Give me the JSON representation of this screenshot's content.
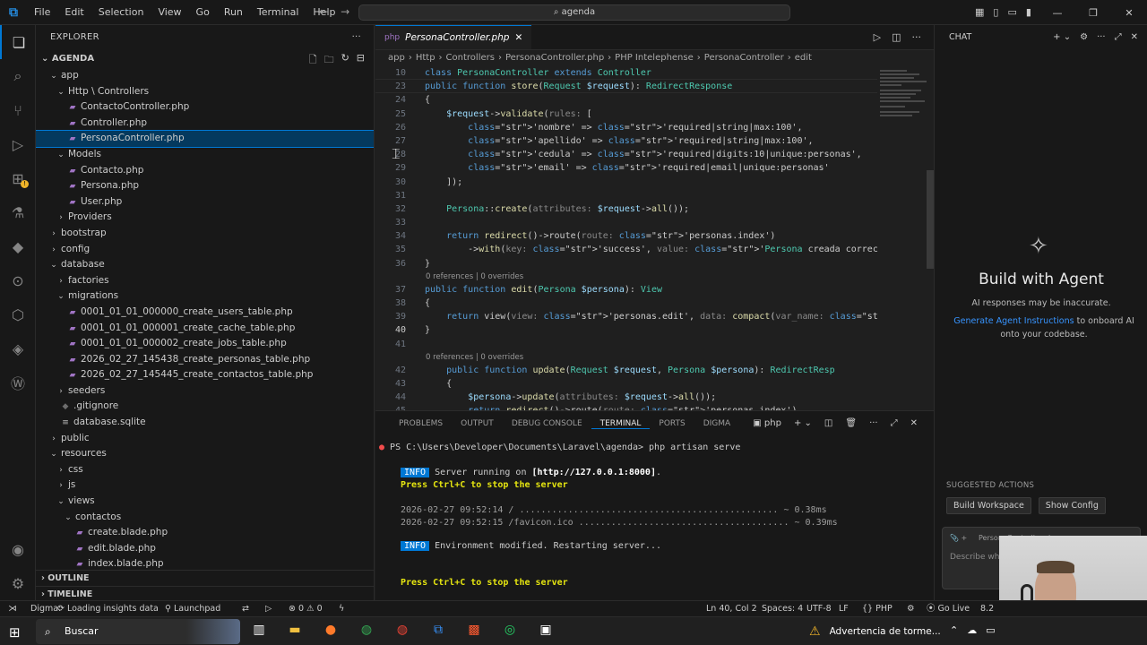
{
  "titlebar": {
    "menu": [
      "File",
      "Edit",
      "Selection",
      "View",
      "Go",
      "Run",
      "Terminal",
      "Help"
    ],
    "search": "agenda"
  },
  "sidebar": {
    "header": "EXPLORER",
    "root": "AGENDA",
    "tree": [
      {
        "label": "app",
        "indent": 1,
        "kind": "folder-open"
      },
      {
        "label": "Http \\ Controllers",
        "indent": 2,
        "kind": "folder-open"
      },
      {
        "label": "ContactoController.php",
        "indent": 3,
        "kind": "php"
      },
      {
        "label": "Controller.php",
        "indent": 3,
        "kind": "php"
      },
      {
        "label": "PersonaController.php",
        "indent": 3,
        "kind": "php",
        "selected": true
      },
      {
        "label": "Models",
        "indent": 2,
        "kind": "folder-open"
      },
      {
        "label": "Contacto.php",
        "indent": 3,
        "kind": "php"
      },
      {
        "label": "Persona.php",
        "indent": 3,
        "kind": "php"
      },
      {
        "label": "User.php",
        "indent": 3,
        "kind": "php"
      },
      {
        "label": "Providers",
        "indent": 2,
        "kind": "folder"
      },
      {
        "label": "bootstrap",
        "indent": 1,
        "kind": "folder"
      },
      {
        "label": "config",
        "indent": 1,
        "kind": "folder"
      },
      {
        "label": "database",
        "indent": 1,
        "kind": "folder-open"
      },
      {
        "label": "factories",
        "indent": 2,
        "kind": "folder"
      },
      {
        "label": "migrations",
        "indent": 2,
        "kind": "folder-open"
      },
      {
        "label": "0001_01_01_000000_create_users_table.php",
        "indent": 3,
        "kind": "php"
      },
      {
        "label": "0001_01_01_000001_create_cache_table.php",
        "indent": 3,
        "kind": "php"
      },
      {
        "label": "0001_01_01_000002_create_jobs_table.php",
        "indent": 3,
        "kind": "php"
      },
      {
        "label": "2026_02_27_145438_create_personas_table.php",
        "indent": 3,
        "kind": "php"
      },
      {
        "label": "2026_02_27_145445_create_contactos_table.php",
        "indent": 3,
        "kind": "php"
      },
      {
        "label": "seeders",
        "indent": 2,
        "kind": "folder"
      },
      {
        "label": ".gitignore",
        "indent": 2,
        "kind": "git"
      },
      {
        "label": "database.sqlite",
        "indent": 2,
        "kind": "db"
      },
      {
        "label": "public",
        "indent": 1,
        "kind": "folder"
      },
      {
        "label": "resources",
        "indent": 1,
        "kind": "folder-open"
      },
      {
        "label": "css",
        "indent": 2,
        "kind": "folder"
      },
      {
        "label": "js",
        "indent": 2,
        "kind": "folder"
      },
      {
        "label": "views",
        "indent": 2,
        "kind": "folder-open"
      },
      {
        "label": "contactos",
        "indent": 3,
        "kind": "folder-open"
      },
      {
        "label": "create.blade.php",
        "indent": 4,
        "kind": "php"
      },
      {
        "label": "edit.blade.php",
        "indent": 4,
        "kind": "php"
      },
      {
        "label": "index.blade.php",
        "indent": 4,
        "kind": "php"
      }
    ],
    "outline": "OUTLINE",
    "timeline": "TIMELINE"
  },
  "editor": {
    "tab": "PersonaController.php",
    "breadcrumb": [
      "app",
      "Http",
      "Controllers",
      "PersonaController.php",
      "PHP Intelephense",
      "PersonaController",
      "edit"
    ],
    "sticky": [
      {
        "ln": "10",
        "text": "class PersonaController extends Controller"
      },
      {
        "ln": "23",
        "text": "public function store(Request $request): RedirectResponse"
      }
    ],
    "lines": [
      {
        "ln": "24",
        "text": "{"
      },
      {
        "ln": "25",
        "text": "    $request->validate(rules: ["
      },
      {
        "ln": "26",
        "text": "        'nombre' => 'required|string|max:100',"
      },
      {
        "ln": "27",
        "text": "        'apellido' => 'required|string|max:100',"
      },
      {
        "ln": "28",
        "text": "        'cedula' => 'required|digits:10|unique:personas',"
      },
      {
        "ln": "29",
        "text": "        'email' => 'required|email|unique:personas'"
      },
      {
        "ln": "30",
        "text": "    ]);"
      },
      {
        "ln": "31",
        "text": ""
      },
      {
        "ln": "32",
        "text": "    Persona::create(attributes: $request->all());"
      },
      {
        "ln": "33",
        "text": ""
      },
      {
        "ln": "34",
        "text": "    return redirect()->route(route: 'personas.index')"
      },
      {
        "ln": "35",
        "text": "        ->with(key: 'success', value: 'Persona creada correctamente');"
      },
      {
        "ln": "36",
        "text": "}"
      },
      {
        "codelens": "0 references | 0 overrides"
      },
      {
        "ln": "37",
        "text": "public function edit(Persona $persona): View"
      },
      {
        "ln": "38",
        "text": "{"
      },
      {
        "ln": "39",
        "text": "    return view(view: 'personas.edit', data: compact(var_name: 'persona'));"
      },
      {
        "ln": "40",
        "text": "}",
        "current": true
      },
      {
        "ln": "41",
        "text": ""
      },
      {
        "codelens": "0 references | 0 overrides"
      },
      {
        "ln": "42",
        "text": "    public function update(Request $request, Persona $persona): RedirectResp"
      },
      {
        "ln": "43",
        "text": "    {"
      },
      {
        "ln": "44",
        "text": "        $persona->update(attributes: $request->all());"
      },
      {
        "ln": "45",
        "text": "        return redirect()->route(route: 'personas.index')"
      }
    ]
  },
  "panel": {
    "tabs": [
      "PROBLEMS",
      "OUTPUT",
      "DEBUG CONSOLE",
      "TERMINAL",
      "PORTS",
      "DIGMA"
    ],
    "active_tab": "TERMINAL",
    "shell": "php",
    "terminal": {
      "prompt": "PS C:\\Users\\Developer\\Documents\\Laravel\\agenda> php artisan serve",
      "info1_badge": "INFO",
      "info1_text": "Server running on ",
      "info1_url": "[http://127.0.0.1:8000]",
      "info1_end": ".",
      "stop1": "Press Ctrl+C to stop the server",
      "log1": "2026-02-27 09:52:14 / ................................................ ~ 0.38ms",
      "log2": "2026-02-27 09:52:15 /favicon.ico ....................................... ~ 0.39ms",
      "info2_badge": "INFO",
      "info2_text": "Environment modified. Restarting server...",
      "stop2": "Press Ctrl+C to stop the server"
    }
  },
  "chat": {
    "header": "CHAT",
    "title": "Build with Agent",
    "subtitle": "AI responses may be inaccurate.",
    "link": "Generate Agent Instructions",
    "link_suffix": " to onboard AI onto your codebase.",
    "suggested_header": "SUGGESTED ACTIONS",
    "suggested": [
      "Build Workspace",
      "Show Config"
    ],
    "input_context": "PersonaController.php",
    "input_placeholder": "Describe wha"
  },
  "statusbar": {
    "digma": "Digma:",
    "loading": "Loading insights data",
    "launchpad": "Launchpad",
    "errors": "0",
    "warnings": "0",
    "position": "Ln 40, Col 2",
    "spaces": "Spaces: 4",
    "encoding": "UTF-8",
    "eol": "LF",
    "language": "PHP",
    "golive": "Go Live",
    "version": "8.2"
  },
  "taskbar": {
    "search": "Buscar",
    "weather": "Advertencia de torme..."
  }
}
